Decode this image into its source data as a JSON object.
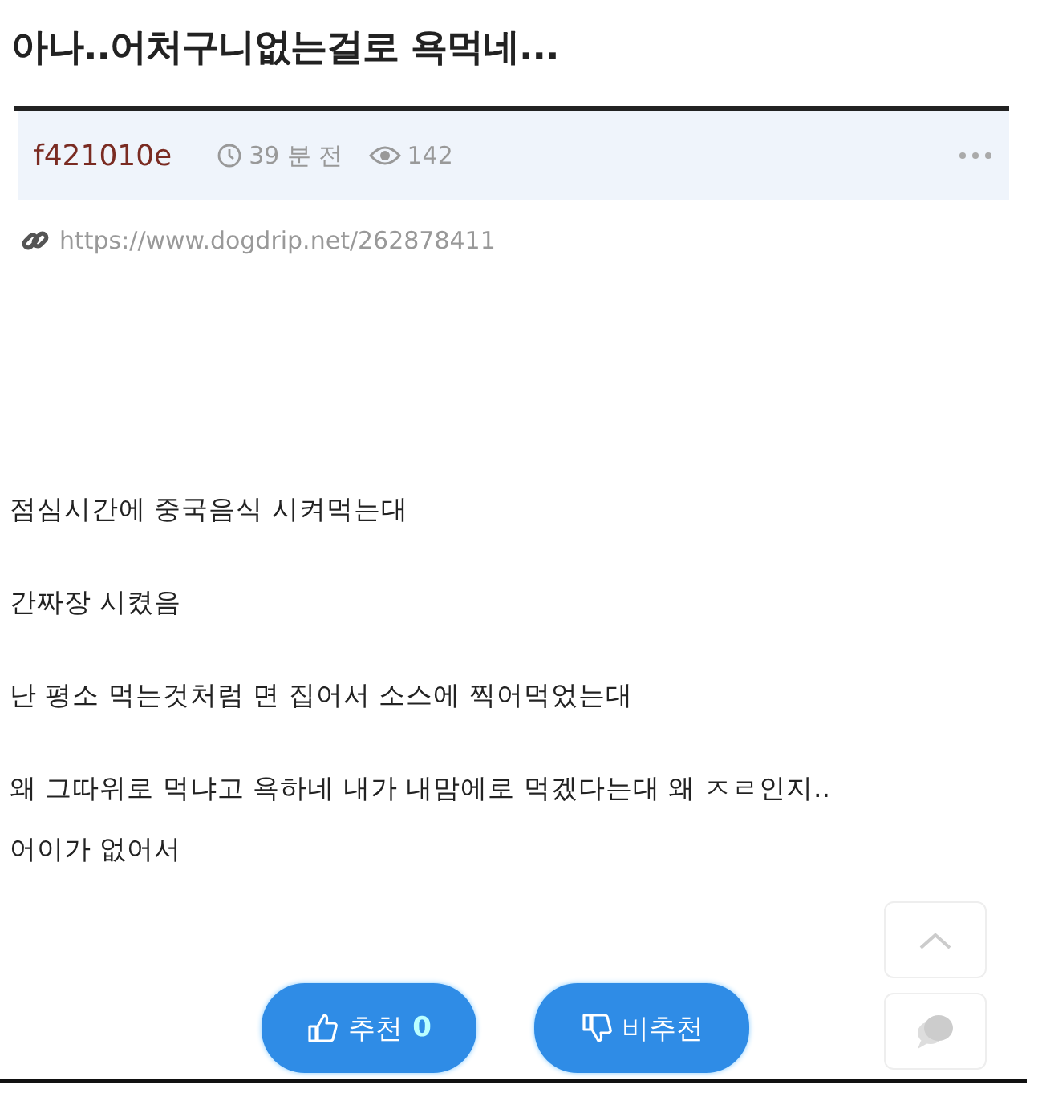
{
  "post": {
    "title": "아나..어처구니없는걸로 욕먹네...",
    "author": "f421010e",
    "time": "39 분 전",
    "views": "142",
    "url": "https://www.dogdrip.net/262878411"
  },
  "body": [
    {
      "lines": [
        "점심시간에 중국음식 시켜먹는대"
      ]
    },
    {
      "lines": [
        "간짜장 시켰음"
      ]
    },
    {
      "lines": [
        "난 평소 먹는것처럼 면 집어서 소스에 찍어먹었는대"
      ]
    },
    {
      "lines": [
        "왜 그따위로 먹냐고 욕하네 내가 내맘에로 먹겠다는대 왜 ㅈㄹ인지..",
        "어이가 없어서"
      ]
    }
  ],
  "votes": [
    {
      "kind": "up",
      "label": "추천",
      "count": "0"
    },
    {
      "kind": "down",
      "label": "비추천"
    }
  ]
}
